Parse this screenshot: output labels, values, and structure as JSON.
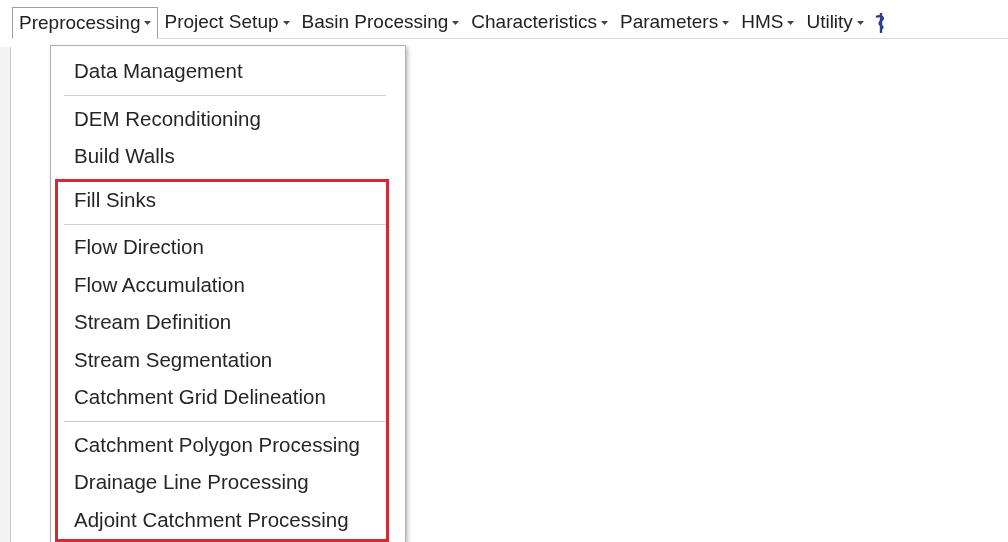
{
  "toolbar": [
    {
      "label": "Preprocessing",
      "open": true
    },
    {
      "label": "Project Setup",
      "open": false
    },
    {
      "label": "Basin Processing",
      "open": false
    },
    {
      "label": "Characteristics",
      "open": false
    },
    {
      "label": "Parameters",
      "open": false
    },
    {
      "label": "HMS",
      "open": false
    },
    {
      "label": "Utility",
      "open": false
    }
  ],
  "menu": {
    "sections": [
      {
        "highlighted": false,
        "groups": [
          [
            "Data Management"
          ],
          [
            "DEM Reconditioning",
            "Build Walls"
          ]
        ]
      },
      {
        "highlighted": true,
        "groups": [
          [
            "Fill Sinks"
          ],
          [
            "Flow Direction",
            "Flow Accumulation",
            "Stream Definition",
            "Stream Segmentation",
            "Catchment Grid Delineation"
          ],
          [
            "Catchment Polygon Processing",
            "Drainage Line Processing",
            "Adjoint Catchment Processing"
          ]
        ]
      }
    ]
  }
}
